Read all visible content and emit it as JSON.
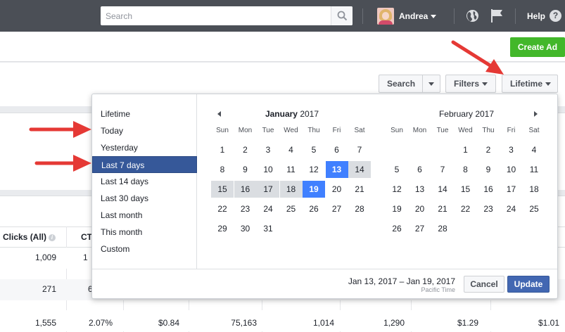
{
  "topbar": {
    "search_placeholder": "Search",
    "user_name": "Andrea",
    "help_label": "Help",
    "help_glyph": "?"
  },
  "header": {
    "create_ad_label": "Create Ad"
  },
  "toolbar": {
    "search_label": "Search",
    "filters_label": "Filters",
    "lifetime_label": "Lifetime"
  },
  "table": {
    "col_clicks": "Clicks (All)",
    "col_ctr": "CT",
    "rows": [
      {
        "clicks": "1,009",
        "ctr": "1"
      },
      {
        "clicks": "271",
        "ctr": "6"
      },
      {
        "clicks": "1,555",
        "ctr": "2.07%",
        "cpc": "$0.84",
        "reach": "75,163",
        "c5": "1,014",
        "c6": "1,290",
        "c7": "$1.29",
        "c8": "$1.01"
      }
    ]
  },
  "date_picker": {
    "presets": [
      "Lifetime",
      "Today",
      "Yesterday",
      "Last 7 days",
      "Last 14 days",
      "Last 30 days",
      "Last month",
      "This month",
      "Custom"
    ],
    "selected_preset": "Last 7 days",
    "weekdays": [
      "Sun",
      "Mon",
      "Tue",
      "Wed",
      "Thu",
      "Fri",
      "Sat"
    ],
    "january": {
      "month": "January",
      "year": "2017",
      "weeks": [
        [
          "1",
          "2",
          "3",
          "4",
          "5",
          "6",
          "7"
        ],
        [
          "8",
          "9",
          "10",
          "11",
          "12",
          "13",
          "14"
        ],
        [
          "15",
          "16",
          "17",
          "18",
          "19",
          "20",
          "21"
        ],
        [
          "22",
          "23",
          "24",
          "25",
          "26",
          "27",
          "28"
        ],
        [
          "29",
          "30",
          "31",
          "",
          "",
          "",
          ""
        ]
      ]
    },
    "february": {
      "month": "February",
      "year": "2017",
      "weeks": [
        [
          "",
          "",
          "",
          "1",
          "2",
          "3",
          "4"
        ],
        [
          "5",
          "6",
          "7",
          "8",
          "9",
          "10",
          "11"
        ],
        [
          "12",
          "13",
          "14",
          "15",
          "16",
          "17",
          "18"
        ],
        [
          "19",
          "20",
          "21",
          "22",
          "23",
          "24",
          "25"
        ],
        [
          "26",
          "27",
          "28",
          "",
          "",
          "",
          ""
        ]
      ]
    },
    "range_start": "13",
    "range_end": "19",
    "range_text": "Jan 13, 2017 – Jan 19, 2017",
    "timezone": "Pacific Time",
    "cancel_label": "Cancel",
    "update_label": "Update"
  },
  "colors": {
    "topbar": "#4b4f56",
    "selected_preset": "#365899",
    "range_endpoint": "#4080ff",
    "range_fill": "#dadde1",
    "create_ad": "#42b72a",
    "update_button": "#4267b2",
    "annotation_arrow": "#e53935"
  }
}
